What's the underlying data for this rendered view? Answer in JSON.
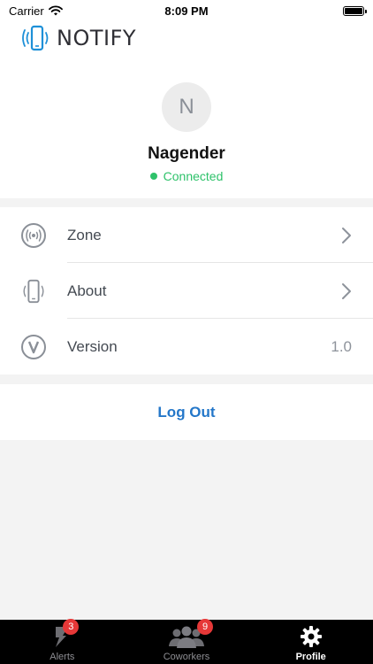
{
  "status_bar": {
    "carrier": "Carrier",
    "time": "8:09 PM"
  },
  "app": {
    "logo_text": "NOTIFY",
    "accent_color": "#2477c9",
    "logo_blue": "#1e90d8"
  },
  "profile": {
    "avatar_initial": "N",
    "name": "Nagender",
    "status": "Connected",
    "status_color": "#2ec26a"
  },
  "menu": {
    "items": [
      {
        "label": "Zone",
        "icon": "zone-broadcast-icon"
      },
      {
        "label": "About",
        "icon": "phone-icon"
      },
      {
        "label": "Version",
        "icon": "v-circle-icon",
        "value": "1.0"
      }
    ]
  },
  "logout": {
    "label": "Log Out"
  },
  "tabbar": {
    "tabs": [
      {
        "label": "Alerts",
        "badge": "3",
        "icon": "alert-flag-icon",
        "active": false
      },
      {
        "label": "Coworkers",
        "badge": "9",
        "icon": "coworkers-icon",
        "active": false
      },
      {
        "label": "Profile",
        "icon": "gear-icon",
        "active": true
      }
    ]
  }
}
